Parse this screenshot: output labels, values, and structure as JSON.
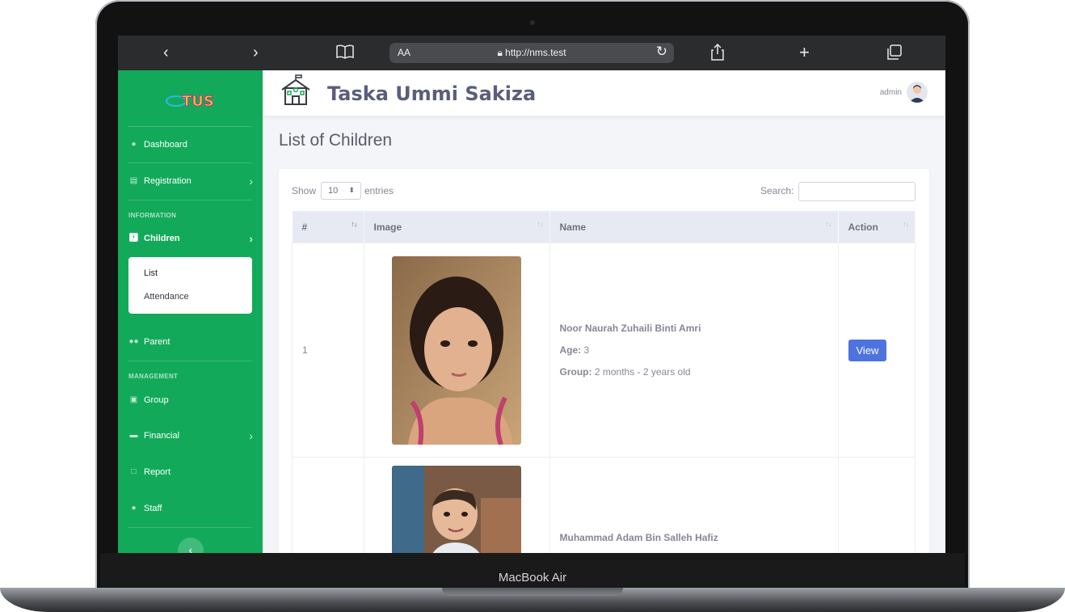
{
  "device": {
    "model": "MacBook Air"
  },
  "browser": {
    "text_size_label": "AA",
    "url": "http://nms.test",
    "icons": [
      "chevron-left-icon",
      "chevron-right-icon",
      "book-icon",
      "lock-icon",
      "reload-icon",
      "share-icon",
      "plus-icon",
      "tabs-icon"
    ]
  },
  "app": {
    "brand": "Taska Ummi Sakiza",
    "logo_text": "TUS",
    "user": "admin",
    "accent_color": "#12aa5a",
    "primary_button_color": "#4e73df"
  },
  "sidebar": {
    "items": [
      {
        "label": "Dashboard",
        "icon": "dashboard-icon"
      },
      {
        "label": "Registration",
        "icon": "registration-icon"
      },
      {
        "header": "INFORMATION"
      },
      {
        "label": "Children",
        "icon": "child-icon",
        "active": true
      },
      {
        "label": "Parent",
        "icon": "users-icon"
      },
      {
        "header": "MANAGEMENT"
      },
      {
        "label": "Group",
        "icon": "group-icon"
      },
      {
        "label": "Financial",
        "icon": "money-icon"
      },
      {
        "label": "Report",
        "icon": "report-icon"
      },
      {
        "label": "Staff",
        "icon": "staff-icon"
      }
    ],
    "submenu": [
      "List",
      "Attendance"
    ]
  },
  "page": {
    "title": "List of Children"
  },
  "table": {
    "show_label": "Show",
    "entries_value": "10",
    "entries_label": "entries",
    "search_label": "Search:",
    "search_value": "",
    "columns": [
      "#",
      "Image",
      "Name",
      "Action"
    ],
    "rows": [
      {
        "no": "1",
        "name": "Noor Naurah Zuhaili Binti Amri",
        "age_label": "Age:",
        "age": "3",
        "group_label": "Group:",
        "group": "2 months - 2 years old",
        "action": "View"
      },
      {
        "no": "",
        "name": "Muhammad Adam Bin Salleh Hafiz",
        "age_label": "",
        "age": "",
        "group_label": "",
        "group": "",
        "action": ""
      }
    ]
  }
}
